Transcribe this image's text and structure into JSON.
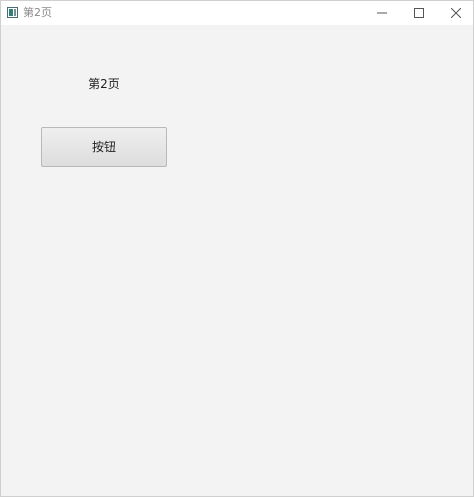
{
  "window": {
    "title": "第2页",
    "controls": {
      "minimize": "minimize-icon",
      "maximize": "maximize-icon",
      "close": "close-icon"
    }
  },
  "content": {
    "page_label": "第2页",
    "button_label": "按钮"
  },
  "colors": {
    "background": "#f3f3f3",
    "titlebar": "#ffffff",
    "button_border": "#b9b9b9"
  }
}
